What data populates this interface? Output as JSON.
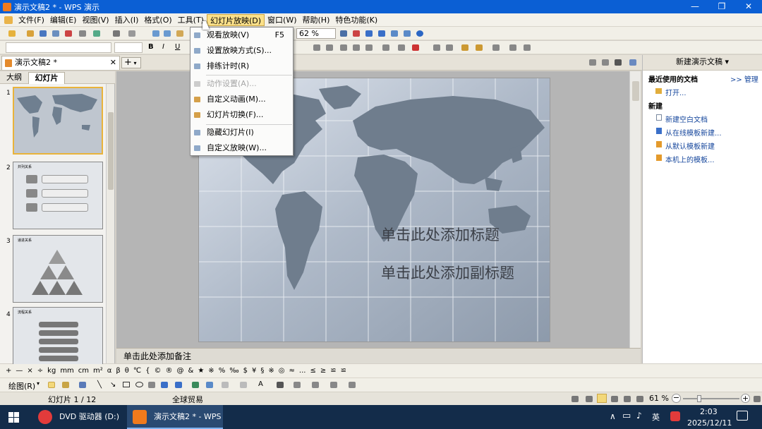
{
  "window": {
    "title": "演示文稿2 * - WPS 演示"
  },
  "menubar": {
    "items": [
      "文件(F)",
      "编辑(E)",
      "视图(V)",
      "插入(I)",
      "格式(O)",
      "工具(T)",
      "幻灯片放映(D)",
      "窗口(W)",
      "帮助(H)",
      "特色功能(K)"
    ]
  },
  "toolbar": {
    "zoom": "62 %"
  },
  "dropdown": {
    "items": [
      {
        "label": "观看放映(V)",
        "shortcut": "F5",
        "enabled": true
      },
      {
        "label": "设置放映方式(S)...",
        "shortcut": "",
        "enabled": true
      },
      {
        "label": "排练计时(R)",
        "shortcut": "",
        "enabled": true
      },
      {
        "label": "动作设置(A)...",
        "shortcut": "",
        "enabled": false
      },
      {
        "label": "自定义动画(M)...",
        "shortcut": "",
        "enabled": true
      },
      {
        "label": "幻灯片切换(F)...",
        "shortcut": "",
        "enabled": true
      },
      {
        "label": "隐藏幻灯片(I)",
        "shortcut": "",
        "enabled": true
      },
      {
        "label": "自定义放映(W)...",
        "shortcut": "",
        "enabled": true
      }
    ]
  },
  "doc_tab": {
    "label": "演示文稿2 *"
  },
  "left_panel": {
    "tabs": [
      "大纲",
      "幻灯片"
    ],
    "slides": [
      {
        "num": "1",
        "title": ""
      },
      {
        "num": "2",
        "title": "并列关系"
      },
      {
        "num": "3",
        "title": "递进关系"
      },
      {
        "num": "4",
        "title": "流程关系"
      }
    ]
  },
  "slide": {
    "title": "单击此处添加标题",
    "subtitle": "单击此处添加副标题"
  },
  "notes": {
    "placeholder": "单击此处添加备注"
  },
  "task_pane": {
    "header": "新建演示文稿",
    "recent_label": "最近使用的文档",
    "manage_link": ">> 管理",
    "open_link": "打开...",
    "new_label": "新建",
    "new_links": [
      "新建空白文档",
      "从在线模板新建...",
      "从默认模板新建",
      "本机上的模板..."
    ]
  },
  "symbols": [
    "+",
    "—",
    "×",
    "÷",
    "kg",
    "mm",
    "cm",
    "m²",
    "α",
    "β",
    "θ",
    "℃",
    "{",
    "©",
    "®",
    "@",
    "&",
    "★",
    "※",
    "%",
    "‰",
    "$",
    "¥",
    "§",
    "※",
    "◎",
    "≈",
    "...",
    "≤",
    "≥",
    "≌",
    "≌"
  ],
  "drawbar": {
    "label": "绘图(R)"
  },
  "statusbar": {
    "slide_info": "幻灯片 1 / 12",
    "design": "全球贸易",
    "zoom": "61 %"
  },
  "taskbar": {
    "items": [
      "DVD 驱动器 (D:) W...",
      "演示文稿2 * - WPS ..."
    ],
    "ime": "英",
    "time": "2:03",
    "date": "2025/12/11"
  },
  "colors": {
    "title_bar": "#0b5fd4",
    "menu_highlight": "#fbe089",
    "taskbar": "#132c4a",
    "link": "#15469c"
  }
}
